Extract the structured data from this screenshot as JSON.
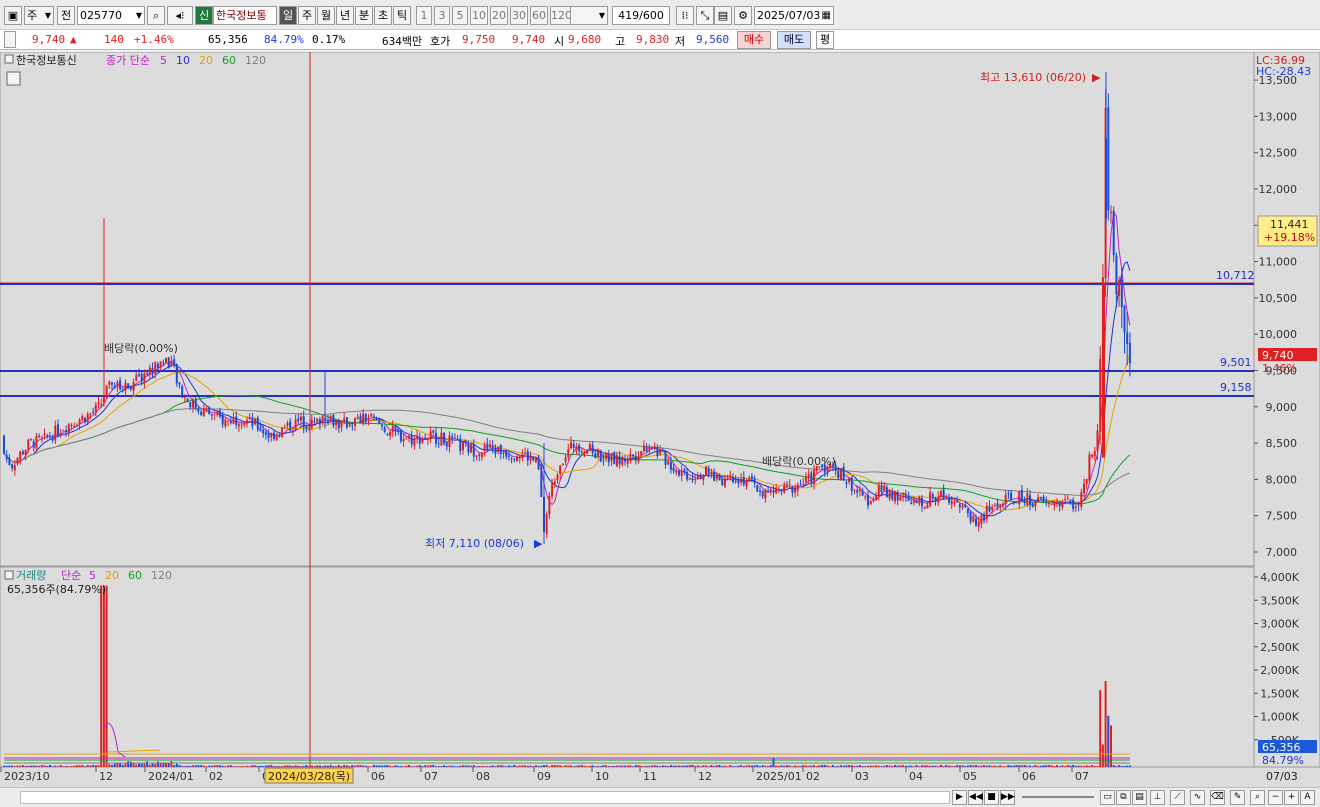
{
  "toolbar": {
    "market": "주",
    "prev_label": "전",
    "code": "025770",
    "credit_badge": "신",
    "name": "한국정보통",
    "periods": [
      "일",
      "주",
      "월",
      "년",
      "분",
      "초",
      "틱"
    ],
    "active_period": "일",
    "numbers": [
      "1",
      "3",
      "5",
      "10",
      "20",
      "30",
      "60",
      "120"
    ],
    "count": "419",
    "count_max": "/600",
    "date": "2025/07/03"
  },
  "quote": {
    "price": "9,740",
    "up_arrow": "▲",
    "change": "140",
    "change_pct": "+1.46%",
    "volume": "65,356",
    "vol_ratio": "84.79%",
    "turnover": "0.17%",
    "amount": "634백만",
    "hoga_label": "호가",
    "hoga_ask": "9,750",
    "hoga_bid": "9,740",
    "open_label": "시",
    "open": "9,680",
    "high_label": "고",
    "high": "9,830",
    "low_label": "저",
    "low": "9,560",
    "buy_label": "매수",
    "sell_label": "매도",
    "flat_label": "평"
  },
  "price_legend": {
    "name": "한국정보통신",
    "type": "종가 단순",
    "ma": [
      "5",
      "10",
      "20",
      "60",
      "120"
    ],
    "ma_colors": [
      "#c020c0",
      "#2030d0",
      "#e8a000",
      "#10a020",
      "#808080"
    ]
  },
  "volume_legend": {
    "name": "거래량",
    "type": "단순",
    "ma": [
      "5",
      "20",
      "60",
      "120"
    ],
    "current": "65,356주(84.79%)"
  },
  "right_axis": {
    "lc": "LC:36.99",
    "hc": "HC:-28.43",
    "cursor_price": "11,441",
    "cursor_pct": "+19.18%",
    "current_price": "9,740",
    "current_pct": "1.46%",
    "vol_current": "65,356",
    "vol_pct": "84.79%",
    "price_ticks": [
      "13,500",
      "13,000",
      "12,500",
      "12,000",
      "11,500",
      "11,000",
      "10,500",
      "10,000",
      "9,500",
      "9,000",
      "8,500",
      "8,000",
      "7,500",
      "7,000"
    ],
    "volume_ticks": [
      "4,000K",
      "3,500K",
      "3,000K",
      "2,500K",
      "2,000K",
      "1,500K",
      "1,000K",
      "500K"
    ]
  },
  "annotations": {
    "high": "최고 13,610 (06/20)",
    "low": "최저 7,110 (08/06)",
    "dividend1": "배당락(0.00%)",
    "dividend2": "배당락(0.00%)",
    "line1": "10,712",
    "line2": "9,501",
    "line3": "9,158"
  },
  "x_axis": {
    "labels": [
      "2023/10",
      "12",
      "2024/01",
      "02",
      "05",
      "06",
      "07",
      "08",
      "09",
      "10",
      "11",
      "12",
      "2025/01",
      "02",
      "03",
      "04",
      "05",
      "06",
      "07"
    ],
    "cursor_date": "2024/03/28(목)",
    "right_date": "07/03"
  },
  "chart_data": {
    "type": "candlestick",
    "y_range": [
      7000,
      13610
    ],
    "key_levels": [
      10712,
      9501,
      9158
    ],
    "price_path": [
      [
        0,
        8600
      ],
      [
        5,
        8300
      ],
      [
        12,
        8200
      ],
      [
        20,
        8350
      ],
      [
        30,
        8500
      ],
      [
        45,
        8550
      ],
      [
        60,
        8700
      ],
      [
        75,
        8800
      ],
      [
        90,
        8900
      ],
      [
        100,
        9000
      ],
      [
        105,
        9200
      ],
      [
        112,
        9300
      ],
      [
        120,
        9250
      ],
      [
        135,
        9350
      ],
      [
        150,
        9500
      ],
      [
        165,
        9650
      ],
      [
        172,
        9600
      ],
      [
        180,
        9200
      ],
      [
        195,
        9000
      ],
      [
        210,
        8900
      ],
      [
        225,
        8800
      ],
      [
        240,
        8850
      ],
      [
        255,
        8750
      ],
      [
        270,
        8600
      ],
      [
        285,
        8700
      ],
      [
        300,
        8800
      ],
      [
        315,
        8750
      ],
      [
        325,
        8900
      ],
      [
        340,
        8750
      ],
      [
        355,
        8800
      ],
      [
        370,
        8850
      ],
      [
        385,
        8700
      ],
      [
        400,
        8600
      ],
      [
        415,
        8550
      ],
      [
        430,
        8600
      ],
      [
        445,
        8550
      ],
      [
        460,
        8450
      ],
      [
        475,
        8400
      ],
      [
        490,
        8420
      ],
      [
        505,
        8380
      ],
      [
        520,
        8350
      ],
      [
        530,
        8300
      ],
      [
        538,
        8200
      ],
      [
        544,
        7300
      ],
      [
        550,
        7800
      ],
      [
        560,
        8250
      ],
      [
        575,
        8500
      ],
      [
        590,
        8400
      ],
      [
        605,
        8300
      ],
      [
        620,
        8250
      ],
      [
        635,
        8350
      ],
      [
        650,
        8500
      ],
      [
        660,
        8350
      ],
      [
        675,
        8150
      ],
      [
        690,
        8050
      ],
      [
        705,
        8100
      ],
      [
        720,
        8000
      ],
      [
        735,
        8050
      ],
      [
        750,
        7950
      ],
      [
        765,
        7800
      ],
      [
        780,
        7850
      ],
      [
        795,
        7900
      ],
      [
        810,
        8000
      ],
      [
        820,
        8200
      ],
      [
        835,
        8150
      ],
      [
        850,
        7950
      ],
      [
        865,
        7700
      ],
      [
        880,
        7850
      ],
      [
        895,
        7800
      ],
      [
        910,
        7650
      ],
      [
        925,
        7700
      ],
      [
        940,
        7800
      ],
      [
        955,
        7750
      ],
      [
        965,
        7550
      ],
      [
        978,
        7400
      ],
      [
        990,
        7600
      ],
      [
        1005,
        7700
      ],
      [
        1020,
        7750
      ],
      [
        1035,
        7700
      ],
      [
        1050,
        7650
      ],
      [
        1065,
        7700
      ],
      [
        1078,
        7650
      ],
      [
        1085,
        7900
      ],
      [
        1090,
        8300
      ],
      [
        1097,
        8350
      ],
      [
        1103,
        10700
      ],
      [
        1106,
        13200
      ],
      [
        1108,
        11700
      ],
      [
        1112,
        11300
      ],
      [
        1117,
        10700
      ],
      [
        1122,
        10300
      ],
      [
        1126,
        9900
      ],
      [
        1130,
        9740
      ]
    ]
  }
}
